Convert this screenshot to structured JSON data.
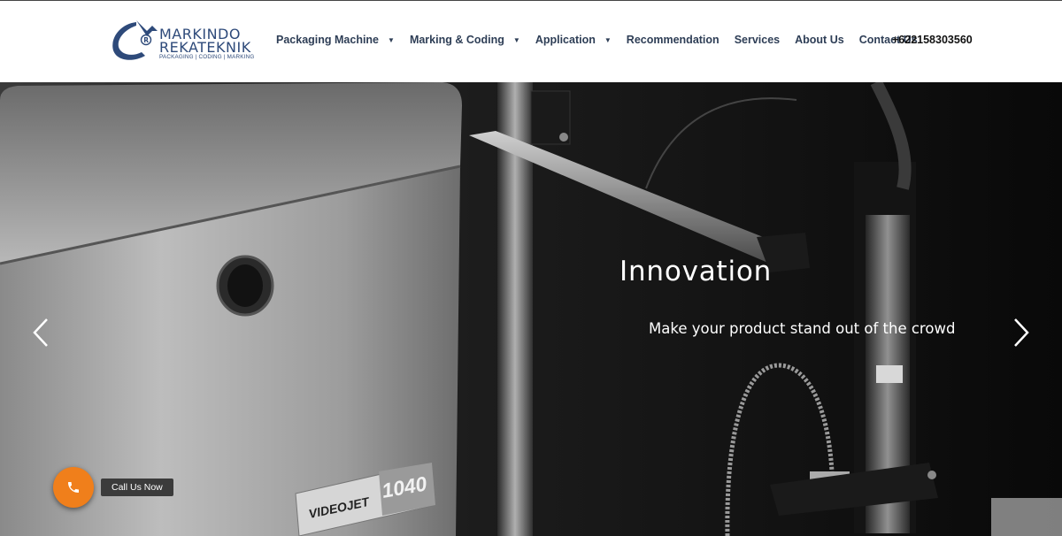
{
  "logo": {
    "line1": "MARKINDO",
    "line2": "REKATEKNIK",
    "tagline": "PACKAGING | CODING | MARKING",
    "brand_color": "#2e4a7a"
  },
  "nav": {
    "items": [
      {
        "label": "Packaging Machine",
        "has_dropdown": true
      },
      {
        "label": "Marking & Coding",
        "has_dropdown": true
      },
      {
        "label": "Application",
        "has_dropdown": true
      },
      {
        "label": "Recommendation",
        "has_dropdown": false
      },
      {
        "label": "Services",
        "has_dropdown": false
      },
      {
        "label": "About Us",
        "has_dropdown": false
      },
      {
        "label": "Contact Us",
        "has_dropdown": false
      }
    ],
    "phone": "+622158303560",
    "caret_glyph": "▼"
  },
  "hero": {
    "title": "Innovation",
    "subtitle": "Make your product stand out of the crowd",
    "machine_label": "VIDEOJET",
    "machine_model": "1040",
    "prev_icon": "chevron-left-icon",
    "next_icon": "chevron-right-icon"
  },
  "call": {
    "tooltip": "Call Us Now",
    "icon": "phone-icon",
    "accent": "#f07f1b"
  }
}
